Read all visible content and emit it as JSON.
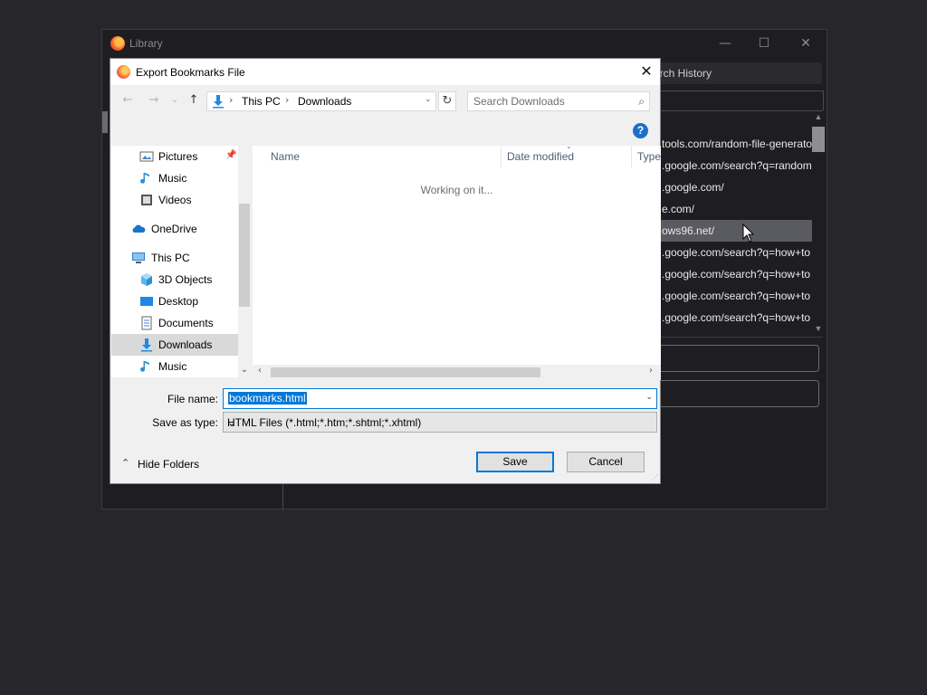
{
  "library": {
    "title": "Library",
    "window_controls": [
      "—",
      "☐",
      "✕"
    ],
    "search_placeholder": "arch History",
    "history_rows": [
      {
        "url": "tools.com/random-file-generato",
        "selected": false
      },
      {
        "url": ".google.com/search?q=random",
        "selected": false
      },
      {
        "url": ".google.com/",
        "selected": false
      },
      {
        "url": "e.com/",
        "selected": false
      },
      {
        "url": "ows96.net/",
        "selected": true
      },
      {
        "url": ".google.com/search?q=how+to",
        "selected": false
      },
      {
        "url": ".google.com/search?q=how+to",
        "selected": false
      },
      {
        "url": ".google.com/search?q=how+to",
        "selected": false
      },
      {
        "url": ".google.com/search?q=how+to",
        "selected": false
      }
    ]
  },
  "dialog": {
    "title": "Export Bookmarks File",
    "close_glyph": "✕",
    "nav": {
      "back": "←",
      "forward": "→",
      "recent": "⌄",
      "up": "↑"
    },
    "address": {
      "crumbs": [
        "This PC",
        "Downloads"
      ],
      "separator": "›"
    },
    "refresh_glyph": "↻",
    "search": {
      "placeholder": "Search Downloads",
      "icon": "⌕"
    },
    "help_glyph": "?",
    "nav_pane": [
      {
        "label": "Pictures",
        "icon": "pictures-icon",
        "pinned": true
      },
      {
        "label": "Music",
        "icon": "music-icon"
      },
      {
        "label": "Videos",
        "icon": "videos-icon"
      },
      {
        "label": "OneDrive",
        "icon": "onedrive-icon"
      },
      {
        "label": "This PC",
        "icon": "this-pc-icon"
      },
      {
        "label": "3D Objects",
        "icon": "3d-objects-icon"
      },
      {
        "label": "Desktop",
        "icon": "desktop-icon"
      },
      {
        "label": "Documents",
        "icon": "documents-icon"
      },
      {
        "label": "Downloads",
        "icon": "downloads-icon",
        "selected": true
      },
      {
        "label": "Music",
        "icon": "music-icon"
      }
    ],
    "columns": [
      "Name",
      "Date modified",
      "Type"
    ],
    "status_text": "Working on it...",
    "file_name_label": "File name:",
    "file_name_value": "bookmarks.html",
    "save_type_label": "Save as type:",
    "save_type_value": "HTML Files (*.html;*.htm;*.shtml;*.xhtml)",
    "hide_folders_label": "Hide Folders",
    "save_label": "Save",
    "cancel_label": "Cancel",
    "colors": {
      "accent": "#0078d7",
      "help": "#1c6fc8",
      "dark_bg": "#26262b"
    }
  }
}
